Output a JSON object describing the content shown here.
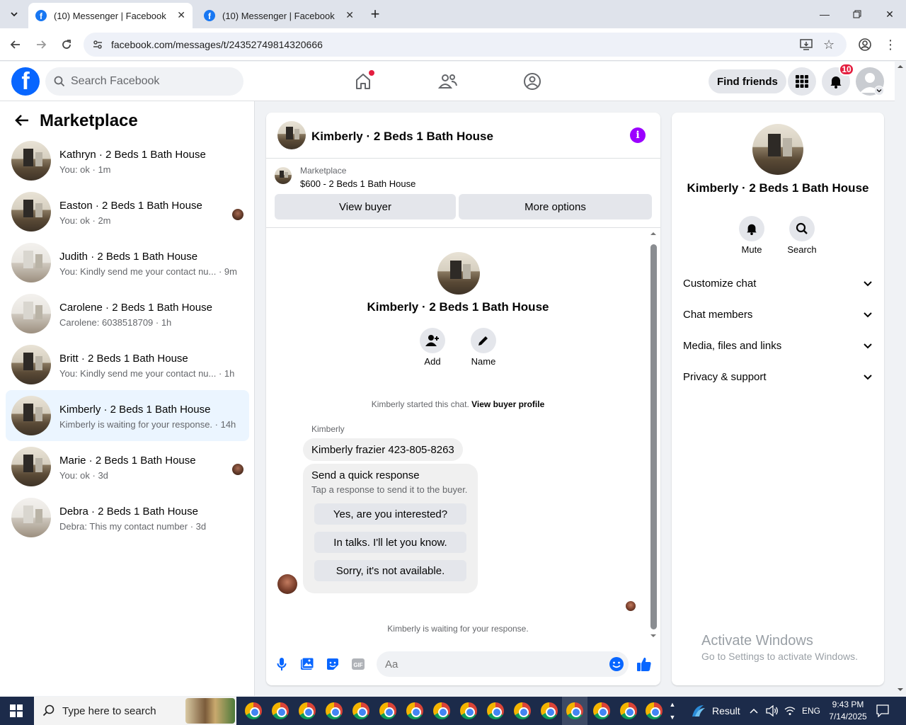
{
  "browser": {
    "tabs": [
      {
        "title": "(10) Messenger | Facebook",
        "active": true
      },
      {
        "title": "(10) Messenger | Facebook",
        "active": false
      }
    ],
    "new_tab": "+",
    "url": "facebook.com/messages/t/24352749814320666"
  },
  "facebook": {
    "search_placeholder": "Search Facebook",
    "find_friends": "Find friends",
    "notification_count": "10"
  },
  "sidebar": {
    "title": "Marketplace",
    "conversations": [
      {
        "name": "Kathryn · 2 Beds 1 Bath House",
        "snippet": "You: ok · 1m",
        "read_avatar": false,
        "selected": false
      },
      {
        "name": "Easton · 2 Beds 1 Bath House",
        "snippet": "You: ok · 2m",
        "read_avatar": true,
        "selected": false
      },
      {
        "name": "Judith · 2 Beds 1 Bath House",
        "snippet": "You: Kindly send me your contact nu... · 9m",
        "read_avatar": false,
        "selected": false
      },
      {
        "name": "Carolene · 2 Beds 1 Bath House",
        "snippet": "Carolene: 6038518709 · 1h",
        "read_avatar": false,
        "selected": false
      },
      {
        "name": "Britt · 2 Beds 1 Bath House",
        "snippet": "You: Kindly send me your contact nu... · 1h",
        "read_avatar": false,
        "selected": false
      },
      {
        "name": "Kimberly · 2 Beds 1 Bath House",
        "snippet": "Kimberly is waiting for your response. · 14h",
        "read_avatar": false,
        "selected": true
      },
      {
        "name": "Marie · 2 Beds 1 Bath House",
        "snippet": "You: ok · 3d",
        "read_avatar": true,
        "selected": false
      },
      {
        "name": "Debra · 2 Beds 1 Bath House",
        "snippet": "Debra: This my contact number · 3d",
        "read_avatar": false,
        "selected": false
      }
    ]
  },
  "chat": {
    "title": "Kimberly · 2 Beds 1 Bath House",
    "marketplace_label": "Marketplace",
    "listing": "$600 - 2 Beds 1 Bath House",
    "view_buyer": "View buyer",
    "more_options": "More options",
    "profile_name": "Kimberly · 2 Beds 1 Bath House",
    "add_label": "Add",
    "name_label": "Name",
    "started_text": "Kimberly started this chat.",
    "view_buyer_profile": "View buyer profile",
    "sender": "Kimberly",
    "message": "Kimberly frazier 423-805-8263",
    "quick_title": "Send a quick response",
    "quick_subtitle": "Tap a response to send it to the buyer.",
    "quick_responses": [
      "Yes, are you interested?",
      "In talks. I'll let you know.",
      "Sorry, it's not available."
    ],
    "waiting_text": "Kimberly is waiting for your response.",
    "composer_placeholder": "Aa"
  },
  "details": {
    "name": "Kimberly · 2 Beds 1 Bath House",
    "mute": "Mute",
    "search": "Search",
    "sections": [
      "Customize chat",
      "Chat members",
      "Media, files and links",
      "Privacy & support"
    ],
    "watermark_title": "Activate Windows",
    "watermark_sub": "Go to Settings to activate Windows."
  },
  "taskbar": {
    "search_placeholder": "Type here to search",
    "weather": "Result",
    "language": "ENG",
    "time": "9:43 PM",
    "date": "7/14/2025"
  }
}
